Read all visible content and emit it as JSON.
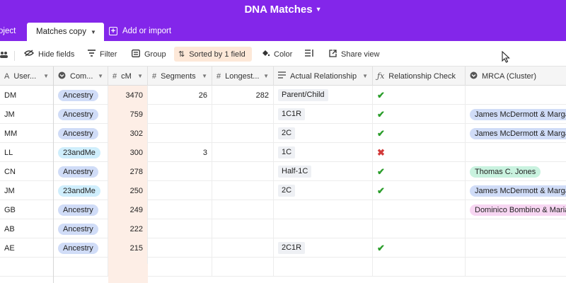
{
  "header": {
    "base_title": "DNA Matches",
    "left_tab_partial": "oject",
    "active_tab": "Matches copy",
    "add_import": "Add or import"
  },
  "toolbar": {
    "hide_fields": "Hide fields",
    "filter": "Filter",
    "group": "Group",
    "sorted": "Sorted by 1 field",
    "color": "Color",
    "share_view": "Share view"
  },
  "columns": [
    {
      "key": "user",
      "label": "User..."
    },
    {
      "key": "company",
      "label": "Com..."
    },
    {
      "key": "cm",
      "label": "cM"
    },
    {
      "key": "segments",
      "label": "Segments"
    },
    {
      "key": "longest",
      "label": "Longest..."
    },
    {
      "key": "actual",
      "label": "Actual Relationship"
    },
    {
      "key": "check",
      "label": "Relationship Check"
    },
    {
      "key": "mrca",
      "label": "MRCA (Cluster)"
    }
  ],
  "rows": [
    {
      "user": "DM",
      "company": "Ancestry",
      "cm": "3470",
      "segments": "26",
      "longest": "282",
      "actual": "Parent/Child",
      "check": "check",
      "mrca": ""
    },
    {
      "user": "JM",
      "company": "Ancestry",
      "cm": "759",
      "segments": "",
      "longest": "",
      "actual": "1C1R",
      "check": "check",
      "mrca": "James McDermott & Marga"
    },
    {
      "user": "MM",
      "company": "Ancestry",
      "cm": "302",
      "segments": "",
      "longest": "",
      "actual": "2C",
      "check": "check",
      "mrca": "James McDermott & Marga"
    },
    {
      "user": "LL",
      "company": "23andMe",
      "cm": "300",
      "segments": "3",
      "longest": "",
      "actual": "1C",
      "check": "cross",
      "mrca": ""
    },
    {
      "user": "CN",
      "company": "Ancestry",
      "cm": "278",
      "segments": "",
      "longest": "",
      "actual": "Half-1C",
      "check": "check",
      "mrca": "Thomas C. Jones"
    },
    {
      "user": "JM",
      "company": "23andMe",
      "cm": "250",
      "segments": "",
      "longest": "",
      "actual": "2C",
      "check": "check",
      "mrca": "James McDermott & Marga"
    },
    {
      "user": "GB",
      "company": "Ancestry",
      "cm": "249",
      "segments": "",
      "longest": "",
      "actual": "",
      "check": "",
      "mrca": "Dominico Bombino & Maria"
    },
    {
      "user": "AB",
      "company": "Ancestry",
      "cm": "222",
      "segments": "",
      "longest": "",
      "actual": "",
      "check": "",
      "mrca": ""
    },
    {
      "user": "AE",
      "company": "Ancestry",
      "cm": "215",
      "segments": "",
      "longest": "",
      "actual": "2C1R",
      "check": "check",
      "mrca": ""
    }
  ],
  "colors": {
    "header_purple": "#8326ea",
    "ancestry_pill": "#d0dcf7",
    "23andme_pill": "#cfeefc",
    "mrca_mcdermott": "#d0dcf7",
    "mrca_jones": "#c9f2df",
    "mrca_bombino": "#f7d6f2",
    "check_green": "#2a9d2a",
    "cross_red": "#d23a3a",
    "cm_highlight": "#fdeee6",
    "sorted_bg": "#fde8d8"
  }
}
